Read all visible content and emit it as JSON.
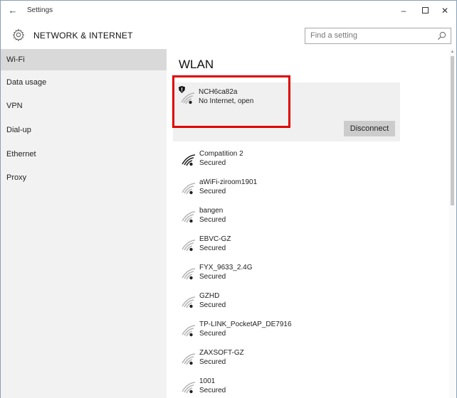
{
  "window": {
    "title": "Settings",
    "back_glyph": "←",
    "minimize_glyph": "–",
    "close_glyph": "✕"
  },
  "header": {
    "section_title": "NETWORK & INTERNET",
    "search_placeholder": "Find a setting",
    "icon": "gear-icon"
  },
  "sidebar": {
    "items": [
      {
        "label": "Wi-Fi",
        "selected": true
      },
      {
        "label": "Data usage",
        "selected": false
      },
      {
        "label": "VPN",
        "selected": false
      },
      {
        "label": "Dial-up",
        "selected": false
      },
      {
        "label": "Ethernet",
        "selected": false
      },
      {
        "label": "Proxy",
        "selected": false
      }
    ]
  },
  "main": {
    "title": "WLAN",
    "connected_network": {
      "name": "NCH6ca82a",
      "status": "No Internet, open",
      "action_label": "Disconnect"
    },
    "networks": [
      {
        "name": "Compatition 2",
        "status": "Secured",
        "strength": 4
      },
      {
        "name": "aWiFi-ziroom1901",
        "status": "Secured",
        "strength": 1
      },
      {
        "name": "bangen",
        "status": "Secured",
        "strength": 1
      },
      {
        "name": "EBVC-GZ",
        "status": "Secured",
        "strength": 1
      },
      {
        "name": "FYX_9633_2.4G",
        "status": "Secured",
        "strength": 1
      },
      {
        "name": "GZHD",
        "status": "Secured",
        "strength": 1
      },
      {
        "name": "TP-LINK_PocketAP_DE7916",
        "status": "Secured",
        "strength": 1
      },
      {
        "name": "ZAXSOFT-GZ",
        "status": "Secured",
        "strength": 1
      },
      {
        "name": "1001",
        "status": "Secured",
        "strength": 1
      }
    ]
  },
  "colors": {
    "highlight": "#e00000",
    "sidebar_bg": "#f2f2f2",
    "sidebar_selected": "#d9d9d9",
    "button_bg": "#cccccc"
  }
}
